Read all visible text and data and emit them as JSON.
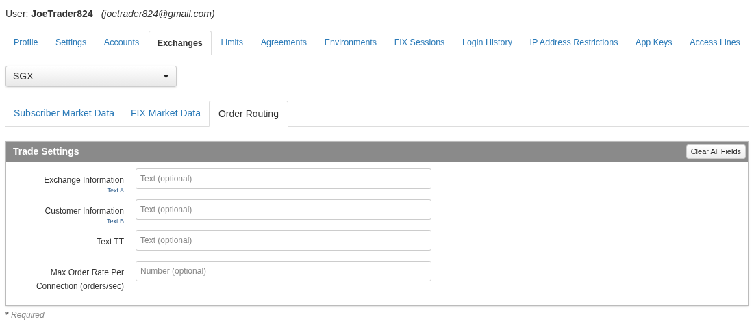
{
  "user": {
    "label": "User:",
    "name": "JoeTrader824",
    "email": "(joetrader824@gmail.com)"
  },
  "tabs": [
    {
      "label": "Profile",
      "selected": false
    },
    {
      "label": "Settings",
      "selected": false
    },
    {
      "label": "Accounts",
      "selected": false
    },
    {
      "label": "Exchanges",
      "selected": true
    },
    {
      "label": "Limits",
      "selected": false
    },
    {
      "label": "Agreements",
      "selected": false
    },
    {
      "label": "Environments",
      "selected": false
    },
    {
      "label": "FIX Sessions",
      "selected": false
    },
    {
      "label": "Login History",
      "selected": false
    },
    {
      "label": "IP Address Restrictions",
      "selected": false
    },
    {
      "label": "App Keys",
      "selected": false
    },
    {
      "label": "Access Lines",
      "selected": false
    }
  ],
  "exchange_select": {
    "value": "SGX"
  },
  "subtabs": [
    {
      "label": "Subscriber Market Data",
      "selected": false
    },
    {
      "label": "FIX Market Data",
      "selected": false
    },
    {
      "label": "Order Routing",
      "selected": true
    }
  ],
  "panel": {
    "title": "Trade Settings",
    "button": "Clear All Fields",
    "fields": [
      {
        "label": "Exchange Information",
        "sublabel": "Text A",
        "placeholder": "Text (optional)"
      },
      {
        "label": "Customer Information",
        "sublabel": "Text B",
        "placeholder": "Text (optional)"
      },
      {
        "label": "Text TT",
        "placeholder": "Text (optional)"
      },
      {
        "label": "Max Order Rate Per Connection (orders/sec)",
        "placeholder": "Number (optional)"
      }
    ]
  },
  "required_note": {
    "mark": "*",
    "label": "Required"
  }
}
